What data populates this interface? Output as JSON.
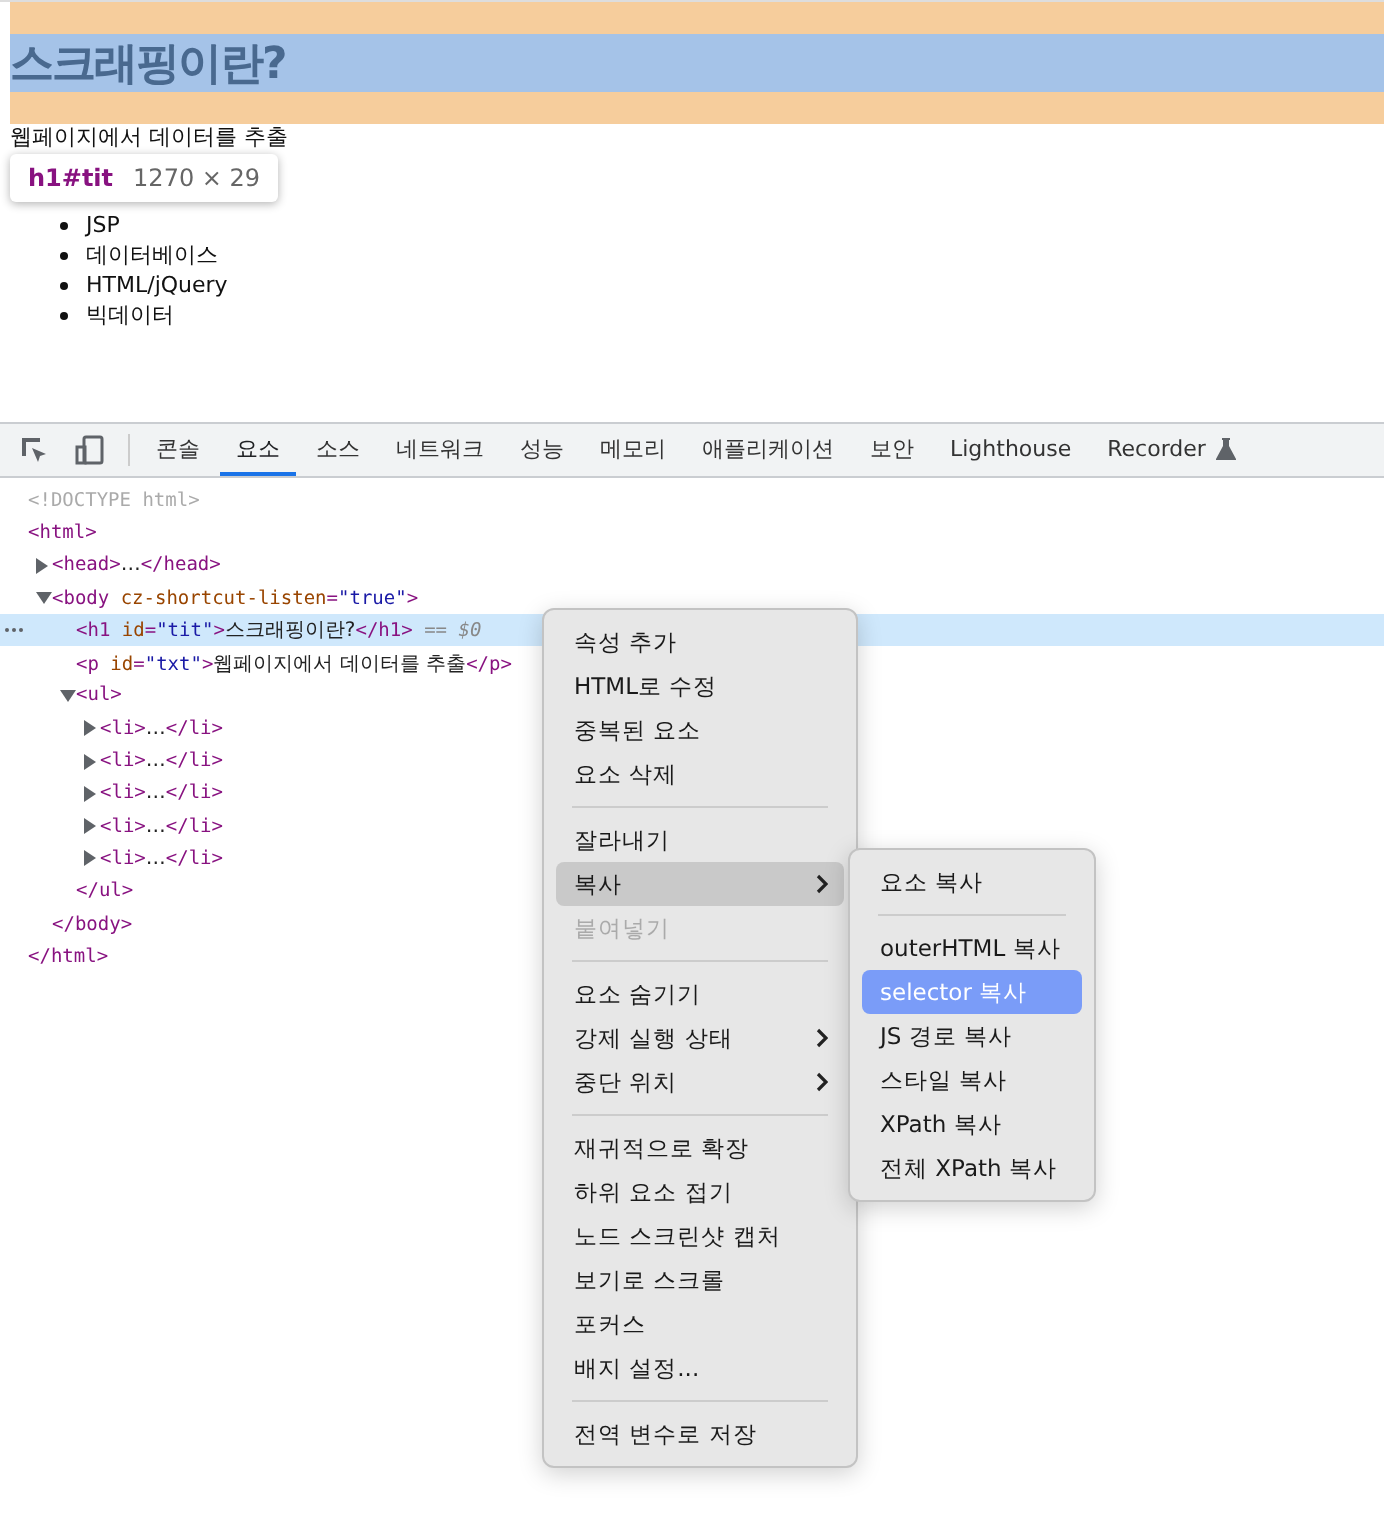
{
  "page": {
    "heading": "스크래핑이란?",
    "paragraph": "웹페이지에서 데이터를 추출",
    "list": [
      "JSP",
      "데이터베이스",
      "HTML/jQuery",
      "빅데이터"
    ]
  },
  "inspect_tooltip": {
    "selector": "h1#tit",
    "size": "1270 × 29"
  },
  "devtools": {
    "tabs": [
      {
        "label": "콘솔",
        "selected": false
      },
      {
        "label": "요소",
        "selected": true
      },
      {
        "label": "소스",
        "selected": false
      },
      {
        "label": "네트워크",
        "selected": false
      },
      {
        "label": "성능",
        "selected": false
      },
      {
        "label": "메모리",
        "selected": false
      },
      {
        "label": "애플리케이션",
        "selected": false
      },
      {
        "label": "보안",
        "selected": false
      },
      {
        "label": "Lighthouse",
        "selected": false
      },
      {
        "label": "Recorder",
        "selected": false,
        "experimental": true
      }
    ],
    "dom_tree": [
      {
        "tokens": [
          {
            "kind": "doctype",
            "s": "<!DOCTYPE html>"
          }
        ],
        "selected": false
      },
      {
        "tokens": [
          {
            "kind": "tag",
            "s": "<html>"
          }
        ],
        "selected": false,
        "close": "</html>",
        "children": [
          {
            "tokens": [
              {
                "kind": "tag",
                "s": "<head>"
              },
              {
                "kind": "text",
                "s": "…"
              },
              {
                "kind": "tag",
                "s": "</head>"
              }
            ],
            "expanded": false,
            "selected": false
          },
          {
            "tokens": [
              {
                "kind": "tag",
                "s": "<body "
              },
              {
                "kind": "attr",
                "s": "cz-shortcut-listen"
              },
              {
                "kind": "tag",
                "s": "="
              },
              {
                "kind": "value",
                "s": "\"true\""
              },
              {
                "kind": "tag",
                "s": ">"
              }
            ],
            "expanded": true,
            "selected": false,
            "close": "</body>",
            "children": [
              {
                "tokens": [
                  {
                    "kind": "tag",
                    "s": "<h1 "
                  },
                  {
                    "kind": "attr",
                    "s": "id"
                  },
                  {
                    "kind": "tag",
                    "s": "="
                  },
                  {
                    "kind": "value",
                    "s": "\"tit\""
                  },
                  {
                    "kind": "tag",
                    "s": ">"
                  },
                  {
                    "kind": "text",
                    "s": "스크래핑이란?"
                  },
                  {
                    "kind": "tag",
                    "s": "</h1>"
                  },
                  {
                    "kind": "marker",
                    "s": " == $0"
                  }
                ],
                "selected": true
              },
              {
                "tokens": [
                  {
                    "kind": "tag",
                    "s": "<p "
                  },
                  {
                    "kind": "attr",
                    "s": "id"
                  },
                  {
                    "kind": "tag",
                    "s": "="
                  },
                  {
                    "kind": "value",
                    "s": "\"txt\""
                  },
                  {
                    "kind": "tag",
                    "s": ">"
                  },
                  {
                    "kind": "text",
                    "s": "웹페이지에서 데이터를 추출"
                  },
                  {
                    "kind": "tag",
                    "s": "</p>"
                  }
                ],
                "selected": false
              },
              {
                "tokens": [
                  {
                    "kind": "tag",
                    "s": "<ul>"
                  }
                ],
                "expanded": true,
                "selected": false,
                "close": "</ul>",
                "children": [
                  {
                    "tokens": [
                      {
                        "kind": "tag",
                        "s": "<li>"
                      },
                      {
                        "kind": "text",
                        "s": "…"
                      },
                      {
                        "kind": "tag",
                        "s": "</li>"
                      }
                    ],
                    "expanded": false,
                    "selected": false
                  },
                  {
                    "tokens": [
                      {
                        "kind": "tag",
                        "s": "<li>"
                      },
                      {
                        "kind": "text",
                        "s": "…"
                      },
                      {
                        "kind": "tag",
                        "s": "</li>"
                      }
                    ],
                    "expanded": false,
                    "selected": false
                  },
                  {
                    "tokens": [
                      {
                        "kind": "tag",
                        "s": "<li>"
                      },
                      {
                        "kind": "text",
                        "s": "…"
                      },
                      {
                        "kind": "tag",
                        "s": "</li>"
                      }
                    ],
                    "expanded": false,
                    "selected": false
                  },
                  {
                    "tokens": [
                      {
                        "kind": "tag",
                        "s": "<li>"
                      },
                      {
                        "kind": "text",
                        "s": "…"
                      },
                      {
                        "kind": "tag",
                        "s": "</li>"
                      }
                    ],
                    "expanded": false,
                    "selected": false
                  },
                  {
                    "tokens": [
                      {
                        "kind": "tag",
                        "s": "<li>"
                      },
                      {
                        "kind": "text",
                        "s": "…"
                      },
                      {
                        "kind": "tag",
                        "s": "</li>"
                      }
                    ],
                    "expanded": false,
                    "selected": false
                  }
                ]
              }
            ]
          }
        ]
      }
    ]
  },
  "context_menu": {
    "items": [
      {
        "kind": "item",
        "label": "속성 추가",
        "selected": false,
        "disabled": false
      },
      {
        "kind": "item",
        "label": "HTML로 수정",
        "selected": false,
        "disabled": false
      },
      {
        "kind": "item",
        "label": "중복된 요소",
        "selected": false,
        "disabled": false
      },
      {
        "kind": "item",
        "label": "요소 삭제",
        "selected": false,
        "disabled": false
      },
      {
        "kind": "separator"
      },
      {
        "kind": "item",
        "label": "잘라내기",
        "selected": false,
        "disabled": false
      },
      {
        "kind": "item",
        "label": "복사",
        "selected": true,
        "disabled": false,
        "submenu": true
      },
      {
        "kind": "item",
        "label": "붙여넣기",
        "selected": false,
        "disabled": true
      },
      {
        "kind": "separator"
      },
      {
        "kind": "item",
        "label": "요소 숨기기",
        "selected": false,
        "disabled": false
      },
      {
        "kind": "item",
        "label": "강제 실행 상태",
        "selected": false,
        "disabled": false,
        "submenu": true
      },
      {
        "kind": "item",
        "label": "중단 위치",
        "selected": false,
        "disabled": false,
        "submenu": true
      },
      {
        "kind": "separator"
      },
      {
        "kind": "item",
        "label": "재귀적으로 확장",
        "selected": false,
        "disabled": false
      },
      {
        "kind": "item",
        "label": "하위 요소 접기",
        "selected": false,
        "disabled": false
      },
      {
        "kind": "item",
        "label": "노드 스크린샷 캡처",
        "selected": false,
        "disabled": false
      },
      {
        "kind": "item",
        "label": "보기로 스크롤",
        "selected": false,
        "disabled": false
      },
      {
        "kind": "item",
        "label": "포커스",
        "selected": false,
        "disabled": false
      },
      {
        "kind": "item",
        "label": "배지 설정...",
        "selected": false,
        "disabled": false
      },
      {
        "kind": "separator"
      },
      {
        "kind": "item",
        "label": "전역 변수로 저장",
        "selected": false,
        "disabled": false
      }
    ],
    "submenu": [
      {
        "kind": "item",
        "label": "요소 복사",
        "selected": false
      },
      {
        "kind": "separator"
      },
      {
        "kind": "item",
        "label": "outerHTML 복사",
        "selected": false
      },
      {
        "kind": "item",
        "label": "selector 복사",
        "selected": true
      },
      {
        "kind": "item",
        "label": "JS 경로 복사",
        "selected": false
      },
      {
        "kind": "item",
        "label": "스타일 복사",
        "selected": false
      },
      {
        "kind": "item",
        "label": "XPath 복사",
        "selected": false
      },
      {
        "kind": "item",
        "label": "전체 XPath 복사",
        "selected": false
      }
    ]
  }
}
